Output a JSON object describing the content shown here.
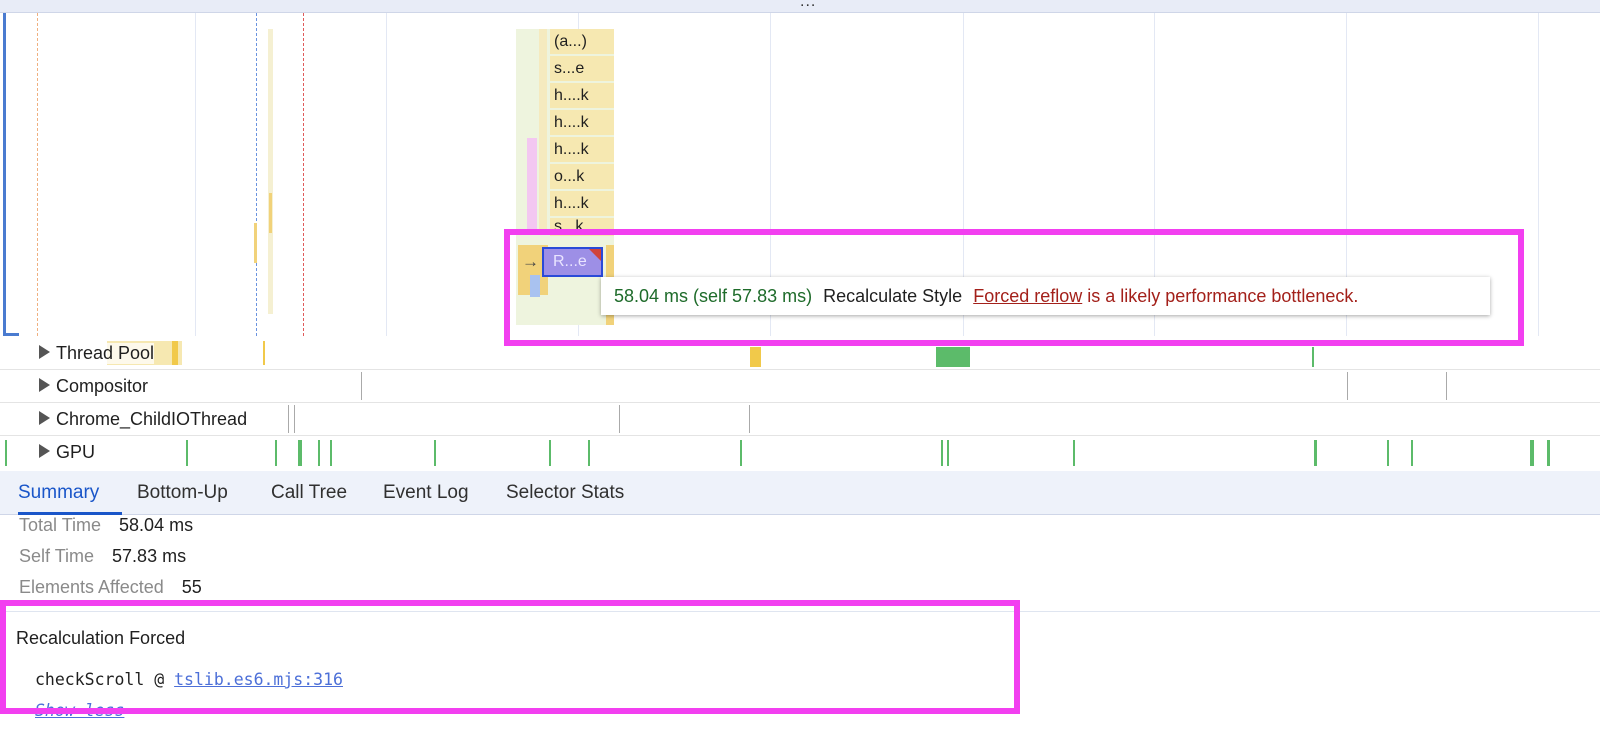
{
  "toolbar": {
    "resize_handle": "..."
  },
  "flame": {
    "frames": [
      "(a...)",
      "s...e",
      "h....k",
      "h....k",
      "h....k",
      "o...k",
      "h....k",
      "s...k"
    ],
    "selected_frame": "R...e"
  },
  "tooltip": {
    "time": "58.04 ms (self 57.83 ms)",
    "name": "Recalculate Style",
    "link": "Forced reflow",
    "warning": "is a likely performance bottleneck."
  },
  "tracks": [
    "Thread Pool",
    "Compositor",
    "Chrome_ChildIOThread",
    "GPU"
  ],
  "tabs": [
    {
      "label": "Summary",
      "active": true
    },
    {
      "label": "Bottom-Up",
      "active": false
    },
    {
      "label": "Call Tree",
      "active": false
    },
    {
      "label": "Event Log",
      "active": false
    },
    {
      "label": "Selector Stats",
      "active": false
    }
  ],
  "summary": {
    "total_time_label": "Total Time",
    "total_time": "58.04 ms",
    "self_time_label": "Self Time",
    "self_time": "57.83 ms",
    "elements_label": "Elements Affected",
    "elements": "55"
  },
  "recalc": {
    "title": "Recalculation Forced",
    "function": "checkScroll",
    "at": "@",
    "source": "tslib.es6.mjs:316",
    "show_less": "Show less"
  },
  "colors": {
    "highlight": "#f23ff0",
    "selected_frame": "#9d8fe6",
    "frame_bg": "#f6e8b1",
    "tooltip_time": "#1e6b2a",
    "tooltip_warning": "#a3201a",
    "tab_active": "#1a56c9",
    "link": "#4c6fd8"
  },
  "icons": {
    "track_expand": "triangle-right-icon",
    "frame_warning": "red-corner-warning-icon",
    "initiator_arrow": "arrow-right-icon"
  }
}
